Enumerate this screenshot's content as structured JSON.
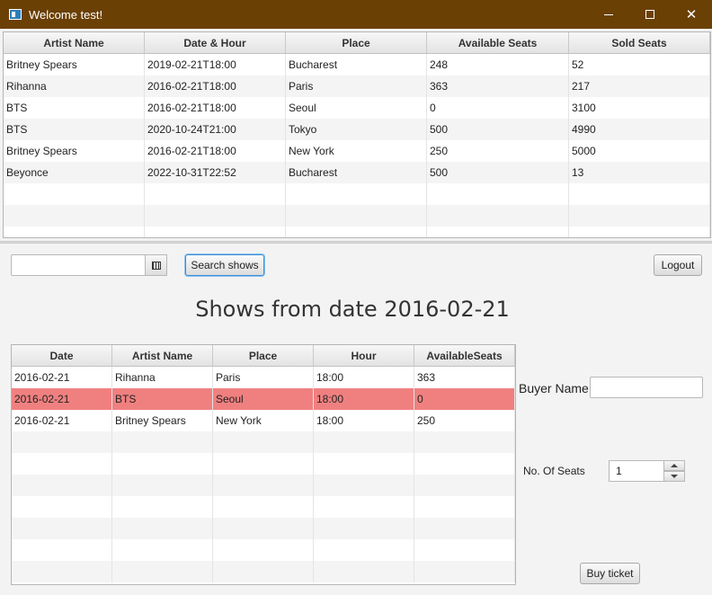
{
  "window": {
    "title": "Welcome test!"
  },
  "top_table": {
    "columns": [
      "Artist Name",
      "Date & Hour",
      "Place",
      "Available Seats",
      "Sold Seats"
    ],
    "rows": [
      [
        "Britney Spears",
        "2019-02-21T18:00",
        "Bucharest",
        "248",
        "52"
      ],
      [
        "Rihanna",
        "2016-02-21T18:00",
        "Paris",
        "363",
        "217"
      ],
      [
        "BTS",
        "2016-02-21T18:00",
        "Seoul",
        "0",
        "3100"
      ],
      [
        "BTS",
        "2020-10-24T21:00",
        "Tokyo",
        "500",
        "4990"
      ],
      [
        "Britney Spears",
        "2016-02-21T18:00",
        "New York",
        "250",
        "5000"
      ],
      [
        "Beyonce",
        "2022-10-31T22:52",
        "Bucharest",
        "500",
        "13"
      ]
    ],
    "empty_rows": 3
  },
  "search": {
    "date_value": "",
    "button_label": "Search shows"
  },
  "logout_label": "Logout",
  "heading": "Shows from date 2016-02-21",
  "bottom_table": {
    "columns": [
      "Date",
      "Artist Name",
      "Place",
      "Hour",
      "AvailableSeats"
    ],
    "rows": [
      [
        "2016-02-21",
        "Rihanna",
        "Paris",
        "18:00",
        "363"
      ],
      [
        "2016-02-21",
        "BTS",
        "Seoul",
        "18:00",
        "0"
      ],
      [
        "2016-02-21",
        "Britney Spears",
        "New York",
        "18:00",
        "250"
      ]
    ],
    "selected_row": 1,
    "selected_color": "#f08080",
    "empty_rows": 7
  },
  "buyer": {
    "label": "Buyer Name",
    "value": ""
  },
  "seats": {
    "label": "No. Of Seats",
    "value": "1"
  },
  "buy_label": "Buy ticket",
  "colors": {
    "titlebar": "#6b4005",
    "focus": "#3c8ed6"
  }
}
